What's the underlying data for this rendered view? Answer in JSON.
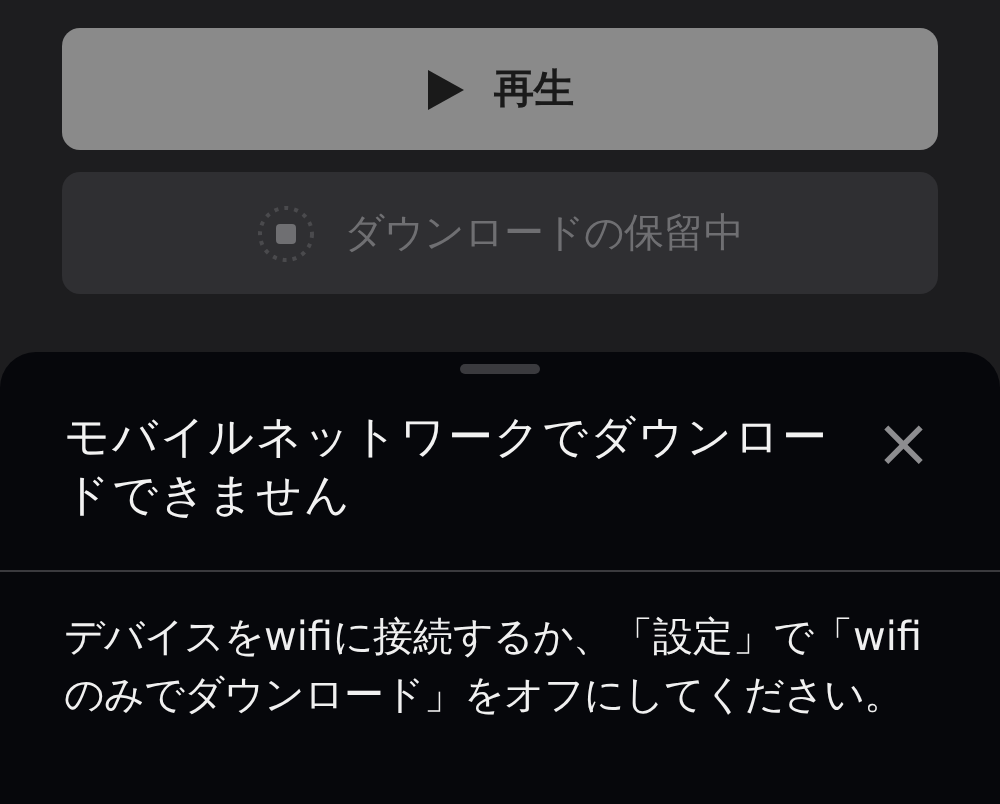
{
  "buttons": [
    {
      "kind": "play",
      "label": "再生",
      "disabled": false
    },
    {
      "kind": "pending",
      "label": "ダウンロードの保留中",
      "disabled": true
    }
  ],
  "sheet": {
    "title": "モバイルネットワークでダウンロードできません",
    "close": "×",
    "message": "デバイスをwifiに接続するか、「設定」で「wifiのみでダウンロード」をオフにしてください。"
  }
}
